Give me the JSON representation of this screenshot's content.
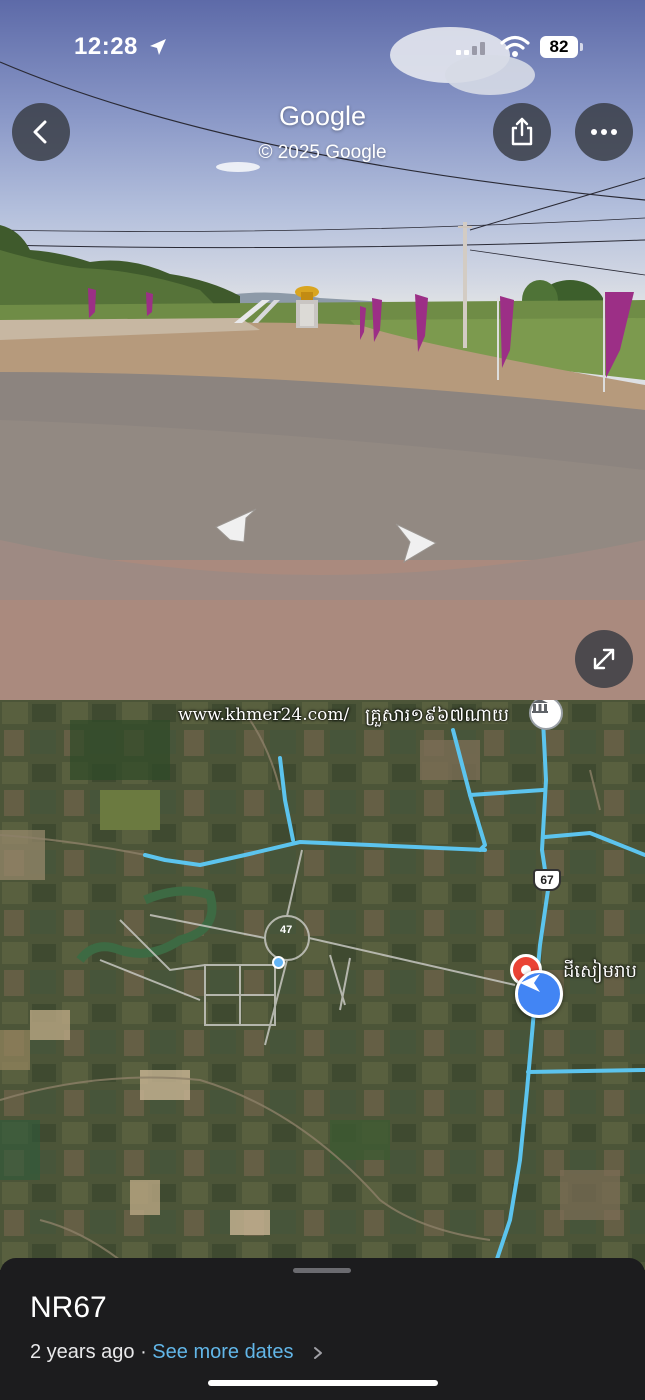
{
  "status_bar": {
    "time": "12:28",
    "battery": "82"
  },
  "street_view": {
    "brand": "Google",
    "copyright": "© 2025 Google"
  },
  "map": {
    "watermark": "www.khmer24.com/",
    "place_label_top": "គ្រួសារ១៩៦៧ណាយ",
    "place_label_pin": "ដីសៀមរាប",
    "route_shield": "67",
    "roundabout_badge": "47"
  },
  "bottom_sheet": {
    "road_name": "NR67",
    "age": "2 years ago",
    "separator": " · ",
    "see_more": "See more dates"
  },
  "icons": [
    "location-arrow-icon",
    "cellular-icon",
    "wifi-icon",
    "back-arrow-icon",
    "share-icon",
    "more-icon",
    "expand-icon",
    "chevron-right-icon",
    "navigation-arrow-icon",
    "museum-icon"
  ],
  "colors": {
    "road_highlight": "#5cc4ee",
    "sheet_bg": "#1c1c1e",
    "link": "#62b6e8",
    "marker_blue": "#4285f4",
    "pin_red": "#ea4335"
  }
}
